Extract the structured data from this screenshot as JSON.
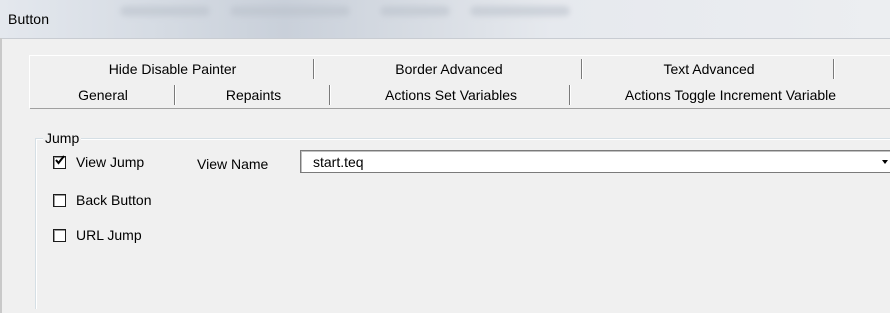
{
  "window": {
    "title": "Button"
  },
  "tabs": {
    "row1": [
      {
        "label": "Hide Disable Painter"
      },
      {
        "label": "Border Advanced"
      },
      {
        "label": "Text Advanced"
      }
    ],
    "row2": [
      {
        "label": "General"
      },
      {
        "label": "Repaints"
      },
      {
        "label": "Actions Set Variables"
      },
      {
        "label": "Actions Toggle Increment Variable"
      }
    ]
  },
  "jump_group": {
    "title": "Jump",
    "view_jump": {
      "label": "View Jump",
      "checked": true
    },
    "back_button": {
      "label": "Back Button",
      "checked": false
    },
    "url_jump": {
      "label": "URL Jump",
      "checked": false
    },
    "view_name": {
      "label": "View Name",
      "value": "start.teq"
    }
  },
  "icons": {
    "checkmark": "check-icon",
    "dropdown": "dropdown-arrow-icon"
  }
}
